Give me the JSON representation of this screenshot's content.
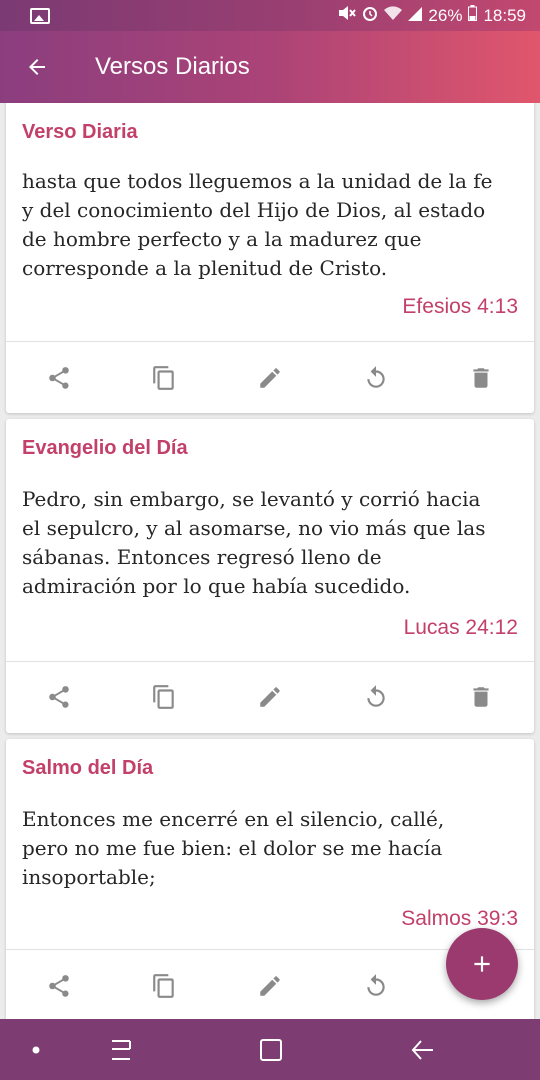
{
  "status_bar": {
    "battery": "26%",
    "time": "18:59",
    "icons": [
      "image-icon",
      "mute-icon",
      "alarm-icon",
      "wifi-icon",
      "signal-icon",
      "battery-icon"
    ]
  },
  "app_bar": {
    "title": "Versos Diarios",
    "back_icon": "arrow-back-icon"
  },
  "cards": [
    {
      "title": "Verso Diaria",
      "text": "hasta que todos lleguemos a la unidad de la fe y del conocimiento del Hijo de Dios, al estado de hombre perfecto y a la madurez que corresponde a la plenitud de Cristo.",
      "reference": "Efesios 4:13"
    },
    {
      "title": "Evangelio del Día",
      "text": "Pedro, sin embargo, se levantó y corrió hacia el sepulcro, y al asomarse, no vio más que las sábanas. Entonces regresó lleno de admiración por lo que había sucedido.",
      "reference": "Lucas 24:12"
    },
    {
      "title": "Salmo del Día",
      "text": "Entonces me encerré en el silencio, callé, pero no me fue bien: el dolor se me hacía insoportable;",
      "reference": "Salmos 39:3"
    }
  ],
  "card_actions": [
    "share-icon",
    "copy-icon",
    "edit-icon",
    "refresh-icon",
    "delete-icon"
  ],
  "fab_icon": "add-icon",
  "nav_bar": [
    "dot-icon",
    "recent-apps-icon",
    "home-icon",
    "back-icon"
  ],
  "colors": {
    "accent": "#c2406a",
    "app_bar_start": "#8b3e7e",
    "app_bar_end": "#e0566c",
    "fab": "#9b3a6e",
    "nav_bar": "#7e3d72"
  }
}
